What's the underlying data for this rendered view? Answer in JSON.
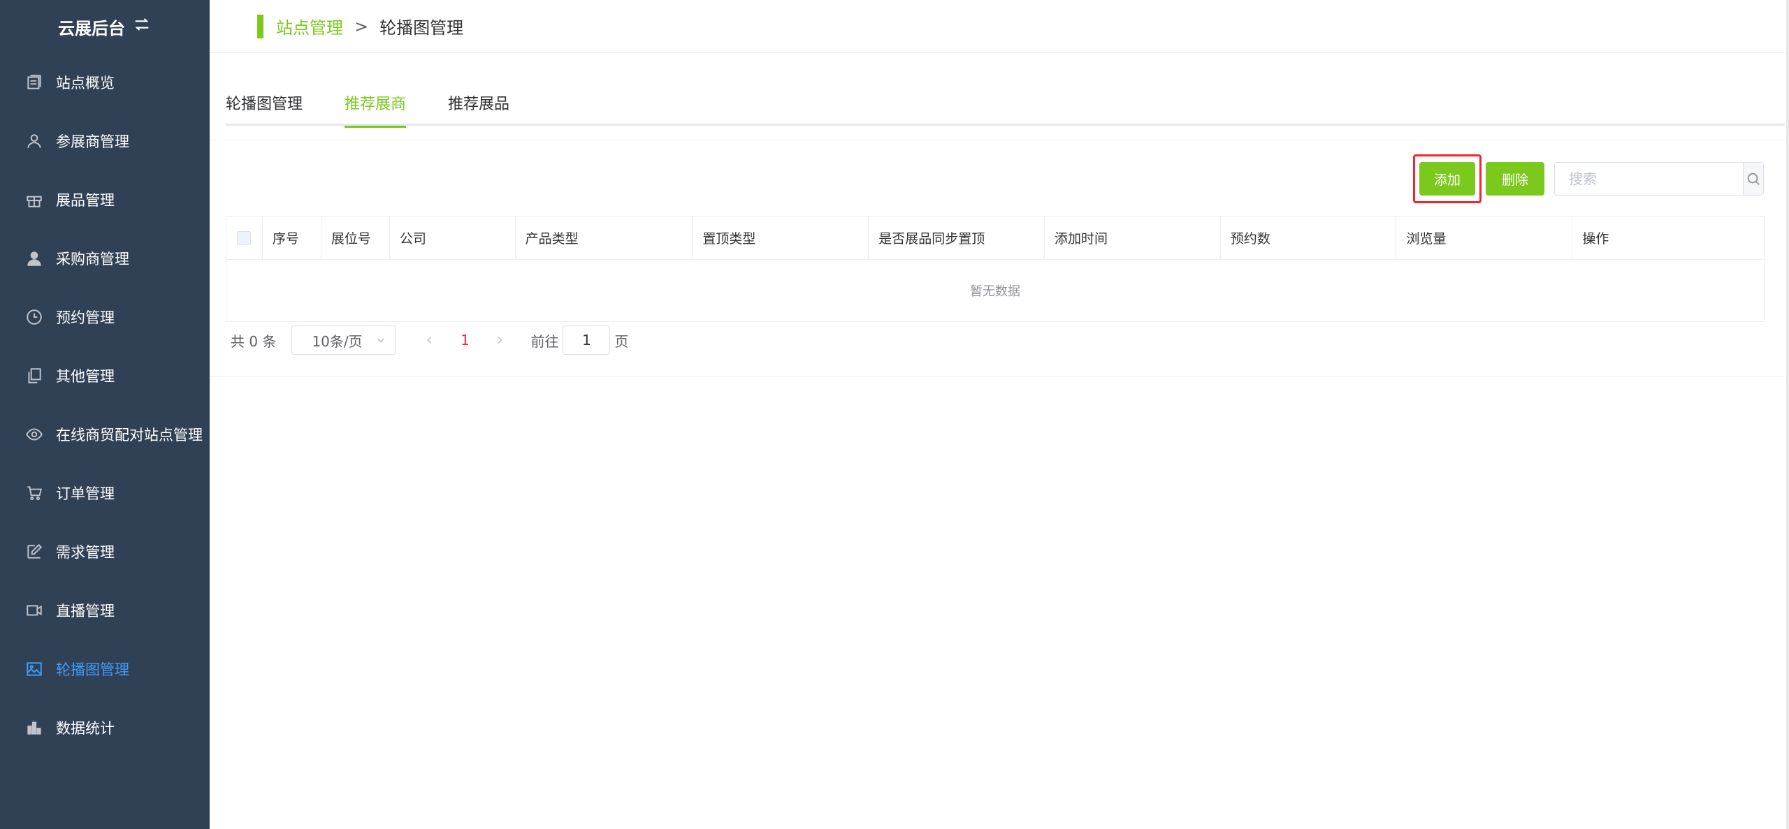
{
  "sidebar": {
    "brand": "云展后台",
    "brand_icon": "swap-icon",
    "items": [
      {
        "label": "站点概览",
        "icon": "overview-icon"
      },
      {
        "label": "参展商管理",
        "icon": "user-outline-icon"
      },
      {
        "label": "展品管理",
        "icon": "gift-icon"
      },
      {
        "label": "采购商管理",
        "icon": "user-solid-icon"
      },
      {
        "label": "预约管理",
        "icon": "clock-icon"
      },
      {
        "label": "其他管理",
        "icon": "copy-icon"
      },
      {
        "label": "在线商贸配对站点管理",
        "icon": "eye-icon"
      },
      {
        "label": "订单管理",
        "icon": "cart-icon"
      },
      {
        "label": "需求管理",
        "icon": "edit-icon"
      },
      {
        "label": "直播管理",
        "icon": "video-icon"
      },
      {
        "label": "轮播图管理",
        "icon": "picture-icon"
      },
      {
        "label": "数据统计",
        "icon": "bar-chart-icon"
      }
    ],
    "active_index": 10
  },
  "breadcrumb": {
    "parent": "站点管理",
    "separator": ">",
    "current": "轮播图管理"
  },
  "tabs": [
    {
      "label": "轮播图管理"
    },
    {
      "label": "推荐展商"
    },
    {
      "label": "推荐展品"
    }
  ],
  "active_tab": 1,
  "toolbar": {
    "add_label": "添加",
    "delete_label": "删除",
    "search_placeholder": "搜索"
  },
  "table": {
    "columns": [
      "序号",
      "展位号",
      "公司",
      "产品类型",
      "置顶类型",
      "是否展品同步置顶",
      "添加时间",
      "预约数",
      "浏览量",
      "操作"
    ],
    "rows": [],
    "empty_text": "暂无数据"
  },
  "pagination": {
    "total_text": "共 0 条",
    "page_size": "10条/页",
    "current_page": "1",
    "goto_label": "前往",
    "goto_value": "1",
    "page_suffix": "页"
  },
  "colors": {
    "sidebar_bg": "#304156",
    "accent": "#7bc91d",
    "active_menu": "#3f9cff",
    "highlight": "#f5222d"
  }
}
